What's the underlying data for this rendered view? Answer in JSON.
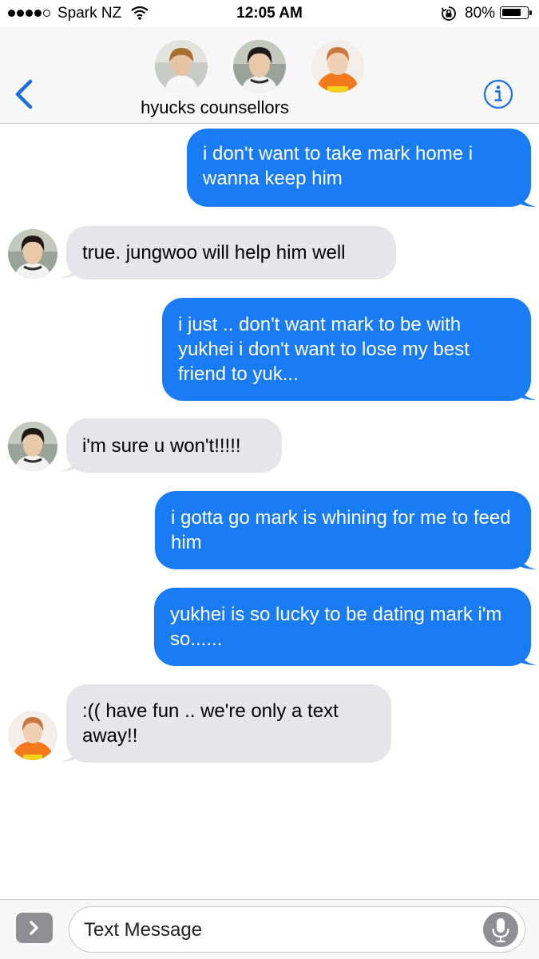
{
  "status_bar": {
    "carrier": "Spark NZ",
    "time": "12:05 AM",
    "battery_percent": "80%",
    "battery_level": 0.8,
    "signal_bars_filled": 4,
    "signal_bars_total": 5
  },
  "header": {
    "group_name": "hyucks counsellors"
  },
  "messages": [
    {
      "direction": "outgoing",
      "text": "i don't want to take mark home i wanna keep him"
    },
    {
      "direction": "incoming",
      "text": "true. jungwoo will help him well"
    },
    {
      "direction": "outgoing",
      "text": "i just .. don't want mark to be with yukhei i don't want to lose my best friend to yuk..."
    },
    {
      "direction": "incoming",
      "text": "i'm sure u won't!!!!!"
    },
    {
      "direction": "outgoing",
      "text": "i gotta go mark is whining for me to feed him"
    },
    {
      "direction": "outgoing",
      "text": "yukhei is so lucky to be dating mark i'm so......"
    },
    {
      "direction": "incoming",
      "text": ":(( have fun .. we're only a text away!!"
    }
  ],
  "composer": {
    "placeholder": "Text Message"
  },
  "colors": {
    "accent": "#1a7cf5",
    "incoming_bubble": "#e5e5ea",
    "link_blue": "#1a6fe0"
  }
}
